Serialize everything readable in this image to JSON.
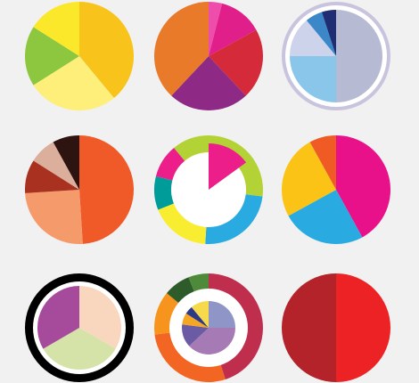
{
  "background": "#f1f1f1",
  "icons": [
    {
      "name": "pie-icon-yellow",
      "kind": "pie",
      "slices": [
        {
          "color": "#f8c31a",
          "fraction": 0.39
        },
        {
          "color": "#fdef7a",
          "fraction": 0.27
        },
        {
          "color": "#8dc63f",
          "fraction": 0.18
        },
        {
          "color": "#fbe82a",
          "fraction": 0.16
        }
      ]
    },
    {
      "name": "pie-icon-warm",
      "kind": "pie",
      "slices": [
        {
          "color": "#ee4dab",
          "fraction": 0.04
        },
        {
          "color": "#e01f8a",
          "fraction": 0.13
        },
        {
          "color": "#d42a3a",
          "fraction": 0.21
        },
        {
          "color": "#8e2a85",
          "fraction": 0.24
        },
        {
          "color": "#e87a2a",
          "fraction": 0.38
        }
      ]
    },
    {
      "name": "pie-icon-blue-ring",
      "kind": "ringed-pie",
      "ring_color": "#c8c4de",
      "slices": [
        {
          "color": "#b7bad3",
          "fraction": 0.5
        },
        {
          "color": "#8ac6ea",
          "fraction": 0.25
        },
        {
          "color": "#cdd3ea",
          "fraction": 0.14
        },
        {
          "color": "#3b87c8",
          "fraction": 0.06
        },
        {
          "color": "#1f2e73",
          "fraction": 0.05
        }
      ]
    },
    {
      "name": "pie-icon-orange",
      "kind": "pie",
      "slices": [
        {
          "color": "#ef5a28",
          "fraction": 0.49
        },
        {
          "color": "#f59a6b",
          "fraction": 0.25
        },
        {
          "color": "#a8321f",
          "fraction": 0.1
        },
        {
          "color": "#dcae9c",
          "fraction": 0.08
        },
        {
          "color": "#2d1410",
          "fraction": 0.08
        }
      ]
    },
    {
      "name": "donut-icon-multicolor",
      "kind": "donut-with-wedge",
      "ring": [
        {
          "color": "#b2d235",
          "fraction": 0.27
        },
        {
          "color": "#29abe2",
          "fraction": 0.24
        },
        {
          "color": "#f9ed32",
          "fraction": 0.18
        },
        {
          "color": "#009c9a",
          "fraction": 0.1
        },
        {
          "color": "#ec1f8a",
          "fraction": 0.1
        },
        {
          "color": "#b2d235",
          "fraction": 0.11
        }
      ],
      "wedge": {
        "color": "#ec1f8a",
        "start_fraction": 0.0,
        "fraction": 0.15
      }
    },
    {
      "name": "pie-icon-bright",
      "kind": "pie",
      "slices": [
        {
          "color": "#e9118a",
          "fraction": 0.42
        },
        {
          "color": "#29abe2",
          "fraction": 0.25
        },
        {
          "color": "#fbc315",
          "fraction": 0.25
        },
        {
          "color": "#f05a24",
          "fraction": 0.08
        }
      ]
    },
    {
      "name": "pie-icon-pastel-black-ring",
      "kind": "ringed-pie",
      "ring_color": "#000000",
      "slices": [
        {
          "color": "#f9d7bf",
          "fraction": 0.333
        },
        {
          "color": "#d6e3a8",
          "fraction": 0.333
        },
        {
          "color": "#a64b9c",
          "fraction": 0.334
        }
      ]
    },
    {
      "name": "donut-icon-nested",
      "kind": "nested-donut",
      "outer": [
        {
          "color": "#bf2e4c",
          "fraction": 0.45
        },
        {
          "color": "#f26522",
          "fraction": 0.28
        },
        {
          "color": "#f7941d",
          "fraction": 0.13
        },
        {
          "color": "#2d5c2a",
          "fraction": 0.08
        },
        {
          "color": "#4e8a3a",
          "fraction": 0.06
        }
      ],
      "inner": [
        {
          "color": "#8f95c6",
          "fraction": 0.25
        },
        {
          "color": "#a67ab4",
          "fraction": 0.38
        },
        {
          "color": "#6a5ba4",
          "fraction": 0.14
        },
        {
          "color": "#f5a623",
          "fraction": 0.07
        },
        {
          "color": "#2e3a87",
          "fraction": 0.05
        },
        {
          "color": "#f7d94c",
          "fraction": 0.11
        }
      ]
    },
    {
      "name": "pie-icon-red",
      "kind": "pie",
      "slices": [
        {
          "color": "#ed2224",
          "fraction": 0.5
        },
        {
          "color": "#b4222a",
          "fraction": 0.5
        }
      ]
    }
  ]
}
